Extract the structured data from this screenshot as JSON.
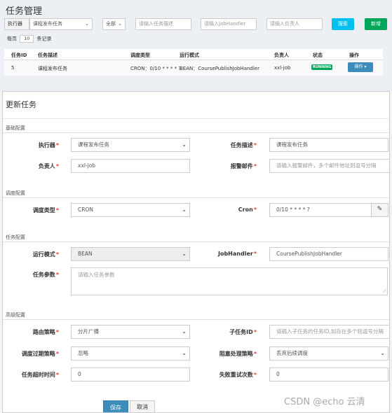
{
  "bg": {
    "title": "任务管理",
    "executor_label": "执行器",
    "executor_value": "课程发布任务",
    "status_value": "全部",
    "desc_placeholder": "请输入任务描述",
    "handler_placeholder": "请输入JobHandler",
    "owner_placeholder": "请输入负责人",
    "search_label": "搜索",
    "add_label": "新增",
    "per_page_prefix": "每页",
    "per_page_value": "10",
    "per_page_suffix": "条记录",
    "table": {
      "headers": [
        "任务ID",
        "任务描述",
        "调度类型",
        "运行模式",
        "负责人",
        "状态",
        "操作"
      ],
      "row": {
        "id": "5",
        "desc": "课程发布任务",
        "schedule": "CRON：0/10 * * * * ?",
        "mode": "BEAN：CoursePublishJobHandler",
        "owner": "xxl-job",
        "status": "RUNNING",
        "op": "操作 ▾"
      }
    }
  },
  "modal": {
    "title": "更新任务",
    "sections": {
      "basic": "基础配置",
      "schedule": "调度配置",
      "task": "任务配置",
      "advanced": "高级配置"
    },
    "fields": {
      "executor": {
        "label": "执行器",
        "value": "课程发布任务"
      },
      "task_desc": {
        "label": "任务描述",
        "value": "课程发布任务"
      },
      "owner": {
        "label": "负责人",
        "value": "xxl-job"
      },
      "alarm_email": {
        "label": "报警邮件",
        "placeholder": "请输入报警邮件，多个邮件地址则逗号分隔"
      },
      "schedule_type": {
        "label": "调度类型",
        "value": "CRON"
      },
      "cron": {
        "label": "Cron",
        "value": "0/10 * * * * ?"
      },
      "run_mode": {
        "label": "运行模式",
        "value": "BEAN"
      },
      "job_handler": {
        "label": "JobHandler",
        "value": "CoursePublishJobHandler"
      },
      "task_param": {
        "label": "任务参数",
        "placeholder": "请输入任务参数"
      },
      "route_strategy": {
        "label": "路由策略",
        "value": "分片广播"
      },
      "child_id": {
        "label": "子任务ID",
        "placeholder": "请输入子任务的任务ID,如存在多个则逗号分隔"
      },
      "misfire": {
        "label": "调度过期策略",
        "value": "忽略"
      },
      "block": {
        "label": "阻塞处理策略",
        "value": "丢弃后续调度"
      },
      "timeout": {
        "label": "任务超时时间",
        "value": "0"
      },
      "retry": {
        "label": "失败重试次数",
        "value": "0"
      }
    },
    "save_label": "保存",
    "cancel_label": "取消"
  },
  "watermark": "CSDN @echo 云清",
  "colors": {
    "primary": "#3c8dbc",
    "success": "#00a65a",
    "info": "#00c0ef",
    "required": "#e03c3c"
  }
}
